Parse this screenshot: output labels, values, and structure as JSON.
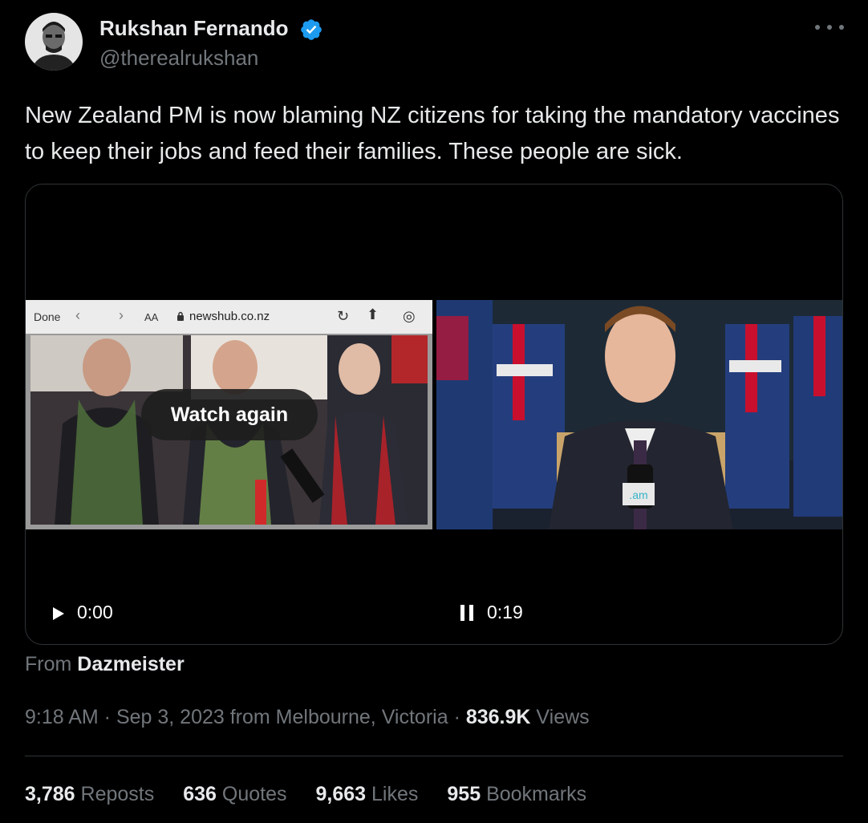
{
  "author": {
    "name": "Rukshan Fernando",
    "handle": "@therealrukshan",
    "verified_color": "#1d9bf0"
  },
  "tweet": {
    "text": "New Zealand PM is now blaming NZ citizens for taking the mandatory vaccines to keep their jobs and feed their families. These people are sick."
  },
  "video": {
    "browser": {
      "done": "Done",
      "aa": "AA",
      "url": "newshub.co.nz"
    },
    "watch_again": "Watch again",
    "time_left": "0:00",
    "time_right": "0:19"
  },
  "source": {
    "prefix": "From",
    "name": "Dazmeister"
  },
  "meta": {
    "time": "9:18 AM",
    "sep1": " · ",
    "date_location": "Sep 3, 2023 from Melbourne, Victoria",
    "sep2": " · ",
    "views_count": "836.9K",
    "views_label": "Views"
  },
  "stats": {
    "reposts_count": "3,786",
    "reposts_label": "Reposts",
    "quotes_count": "636",
    "quotes_label": "Quotes",
    "likes_count": "9,663",
    "likes_label": "Likes",
    "bookmarks_count": "955",
    "bookmarks_label": "Bookmarks"
  }
}
